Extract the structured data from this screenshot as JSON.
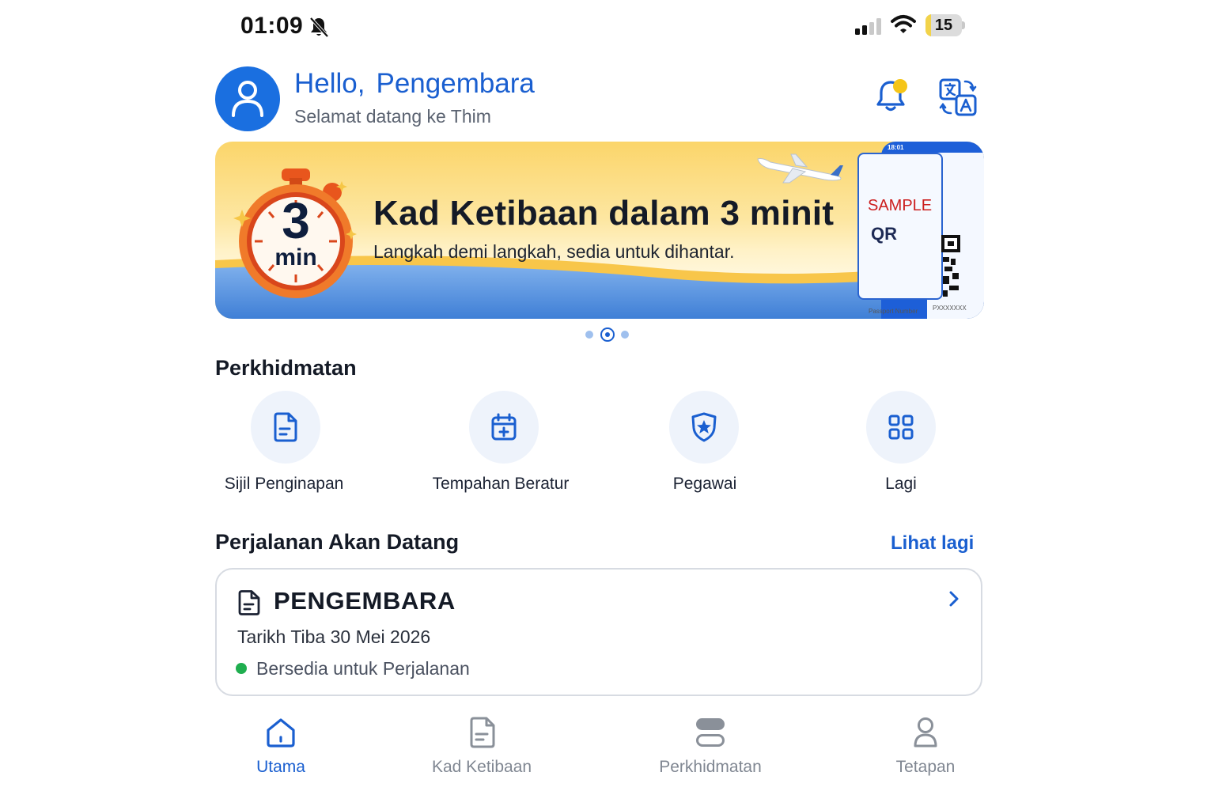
{
  "status_bar": {
    "time": "01:09",
    "battery_level": "15",
    "battery_fraction": 0.15
  },
  "header": {
    "greeting_hello": "Hello,",
    "greeting_name": "Pengembara",
    "subtitle": "Selamat datang ke Thim"
  },
  "banner": {
    "timer_number": "3",
    "timer_unit": "min",
    "title": "Kad Ketibaan dalam 3 minit",
    "subtitle": "Langkah demi langkah, sedia untuk dihantar.",
    "phone_time": "18:01",
    "sample_label": "SAMPLE",
    "qr_label": "QR",
    "passport_label": "Passport Number",
    "passport_value": "PXXXXXXX",
    "carousel_index": 2,
    "carousel_count": 3
  },
  "services": {
    "title": "Perkhidmatan",
    "items": [
      {
        "label": "Sijil Penginapan",
        "icon": "document-icon"
      },
      {
        "label": "Tempahan Beratur",
        "icon": "calendar-plus-icon"
      },
      {
        "label": "Pegawai",
        "icon": "badge-star-icon"
      },
      {
        "label": "Lagi",
        "icon": "grid-icon"
      }
    ]
  },
  "upcoming": {
    "title": "Perjalanan Akan Datang",
    "see_more": "Lihat lagi",
    "trip": {
      "name": "PENGEMBARA",
      "arrival": "Tarikh Tiba 30 Mei 2026",
      "status": "Bersedia untuk Perjalanan",
      "status_color": "#1fae4f"
    }
  },
  "bottom_nav": {
    "items": [
      {
        "label": "Utama",
        "icon": "home-icon",
        "active": true
      },
      {
        "label": "Kad Ketibaan",
        "icon": "card-icon",
        "active": false
      },
      {
        "label": "Perkhidmatan",
        "icon": "services-icon",
        "active": false
      },
      {
        "label": "Tetapan",
        "icon": "person-icon",
        "active": false
      }
    ]
  },
  "colors": {
    "accent": "#1a5fd0",
    "notification_dot": "#f5c518",
    "inactive_nav": "#808792"
  }
}
